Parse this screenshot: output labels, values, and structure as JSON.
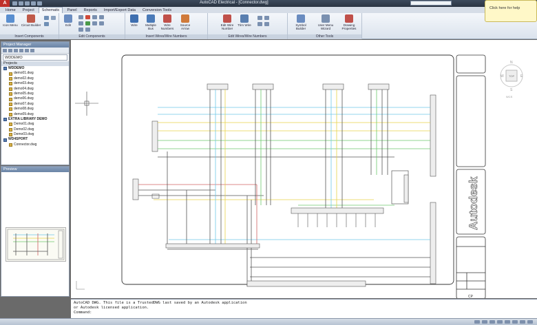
{
  "window": {
    "title": "AutoCAD Electrical - [Connector.dwg]",
    "search_placeholder": "Type a keyword"
  },
  "ribbon": {
    "tabs": [
      "Home",
      "Project",
      "Schematic",
      "Panel",
      "Reports",
      "Import/Export Data",
      "Conversion Tools"
    ],
    "active_tab": "Schematic",
    "panels": [
      {
        "title": "Insert Components",
        "buttons": [
          "Icon Menu",
          "Circuit Builder"
        ]
      },
      {
        "title": "Edit Components",
        "buttons": [
          "Edit"
        ]
      },
      {
        "title": "Insert Wires/Wire Numbers",
        "buttons": [
          "Wire",
          "Multiple Bus",
          "Wire Numbers",
          "Source Arrow"
        ]
      },
      {
        "title": "Edit Wires/Wire Numbers",
        "buttons": [
          "Edit Wire Number",
          "Trim Wire"
        ]
      },
      {
        "title": "Other Tools",
        "buttons": [
          "Symbol Builder",
          "User Menu Wizard",
          "Drawing Properties"
        ]
      }
    ]
  },
  "balloon": {
    "text": "Click here for help"
  },
  "project_manager": {
    "title": "Project Manager",
    "selected_project": "WDDEMO",
    "projects_header": "Projects",
    "items": [
      {
        "label": "WDDEMO",
        "level": 0,
        "kind": "proj"
      },
      {
        "label": "demo01.dwg",
        "level": 1
      },
      {
        "label": "demo02.dwg",
        "level": 1
      },
      {
        "label": "demo03.dwg",
        "level": 1
      },
      {
        "label": "demo04.dwg",
        "level": 1
      },
      {
        "label": "demo05.dwg",
        "level": 1
      },
      {
        "label": "demo06.dwg",
        "level": 1
      },
      {
        "label": "demo07.dwg",
        "level": 1
      },
      {
        "label": "demo08.dwg",
        "level": 1
      },
      {
        "label": "demo09.dwg",
        "level": 1
      },
      {
        "label": "EXTRA LIBRARY DEMO",
        "level": 0,
        "kind": "proj"
      },
      {
        "label": "Demo01.dwg",
        "level": 1
      },
      {
        "label": "Demo02.dwg",
        "level": 1
      },
      {
        "label": "Demo03.dwg",
        "level": 1
      },
      {
        "label": "WD4SPORT",
        "level": 0,
        "kind": "proj"
      },
      {
        "label": "Connector.dwg",
        "level": 1
      }
    ]
  },
  "preview": {
    "title": "Preview"
  },
  "drawing": {
    "title_block": {
      "brand": "Autodesk",
      "sheet": "CP"
    }
  },
  "command_line": {
    "lines": [
      "AutoCAD DWG. This file is a TrustedDWG last saved by an Autodesk application",
      "or Autodesk licensed application.",
      "Command:"
    ]
  },
  "colors": {
    "wire_cyan": "#6fc8e8",
    "wire_yellow": "#e7d24a",
    "wire_green": "#6cc96c",
    "wire_red": "#d06060",
    "wire_dark": "#404040"
  }
}
